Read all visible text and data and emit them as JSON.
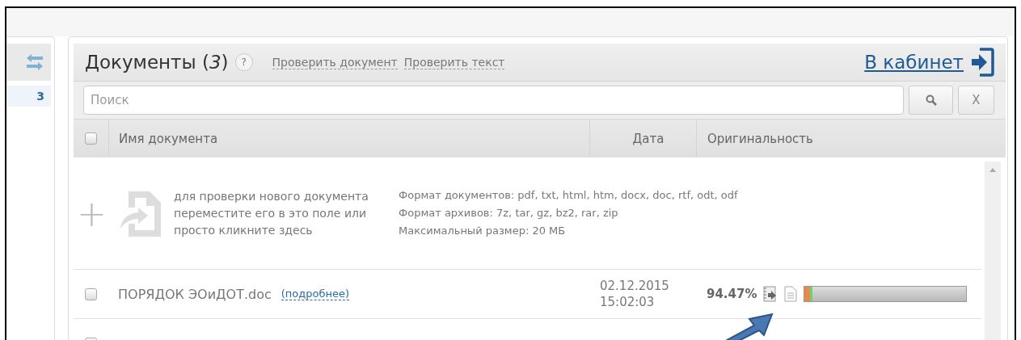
{
  "sidebar": {
    "count": "3"
  },
  "panel": {
    "title": "Документы (*3*)",
    "help": "?",
    "links": [
      "Проверить документ",
      "Проверить текст"
    ],
    "cabinet_link": "В кабинет"
  },
  "search": {
    "placeholder": "Поиск",
    "clear_button": "X"
  },
  "table": {
    "select_all": {
      "checked": false
    },
    "columns": [
      "Имя документа",
      "Дата",
      "Оригинальность"
    ],
    "upload": {
      "plus": "+",
      "hint": "для проверки нового документа переместите его в это поле или просто кликните здесь",
      "info": [
        "Формат документов: pdf, txt, html, htm, docx, doc, rtf, odt, odf",
        "Формат архивов: 7z, tar, gz, bz2, rar, zip",
        "Максимальный размер: 20 МБ"
      ]
    },
    "rows": [
      {
        "checked": false,
        "name": "ПОРЯДОК ЭОиДОТ.doc",
        "details": "(подробнее)",
        "date": "02.12.2015",
        "time": "15:02:03",
        "originality": "94.47%",
        "bar": [
          {
            "color": "#e8894a",
            "level": 0.035
          },
          {
            "color": "#6fd26f",
            "level": 0.015
          }
        ]
      },
      {
        "checked": false
      }
    ]
  }
}
